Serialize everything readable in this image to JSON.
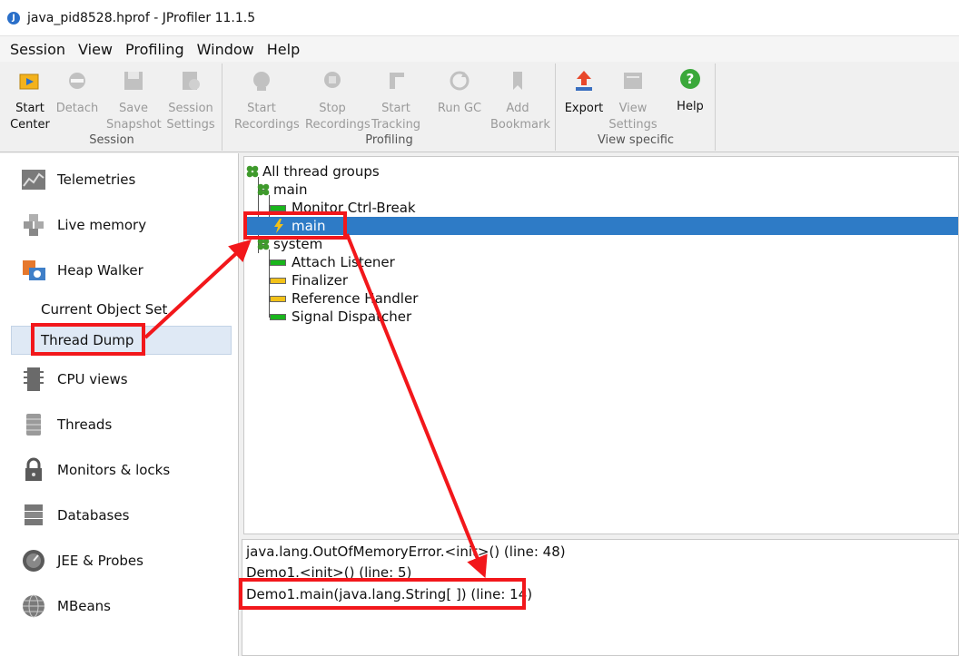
{
  "window": {
    "title": "java_pid8528.hprof - JProfiler 11.1.5"
  },
  "menu": [
    {
      "label": "Session"
    },
    {
      "label": "View"
    },
    {
      "label": "Profiling"
    },
    {
      "label": "Window"
    },
    {
      "label": "Help"
    }
  ],
  "toolbar": {
    "groups": [
      {
        "name": "Session"
      },
      {
        "name": "Profiling"
      },
      {
        "name": "View specific"
      }
    ],
    "buttons": {
      "start_center": "Start\nCenter",
      "detach": "Detach",
      "save_snapshot": "Save\nSnapshot",
      "session_settings": "Session\nSettings",
      "start_recordings": "Start\nRecordings",
      "stop_recordings": "Stop\nRecordings",
      "start_tracking": "Start\nTracking",
      "run_gc": "Run GC",
      "add_bookmark": "Add\nBookmark",
      "export": "Export",
      "view_settings": "View\nSettings",
      "help": "Help"
    }
  },
  "nav": {
    "telemetries": "Telemetries",
    "live_memory": "Live memory",
    "heap_walker": "Heap Walker",
    "current_object_set": "Current Object Set",
    "thread_dump": "Thread Dump",
    "cpu_views": "CPU views",
    "threads": "Threads",
    "monitors_locks": "Monitors & locks",
    "databases": "Databases",
    "jee_probes": "JEE & Probes",
    "mbeans": "MBeans"
  },
  "tree": {
    "root": "All thread groups",
    "group_main": "main",
    "thread_monitor": "Monitor Ctrl-Break",
    "thread_main": "main",
    "group_system": "system",
    "thread_attach": "Attach Listener",
    "thread_finalizer": "Finalizer",
    "thread_reference": "Reference Handler",
    "thread_signal": "Signal Dispatcher"
  },
  "stack": {
    "frame_1": "java.lang.OutOfMemoryError.<init>() (line: 48)",
    "frame_2": "Demo1.<init>() (line: 5)",
    "frame_3": "Demo1.main(java.lang.String[ ]) (line: 14)"
  },
  "colors": {
    "selection": "#2e7bc6",
    "annotation_red": "#f2171b",
    "status_green": "#19b51c",
    "status_yellow": "#f2c118"
  }
}
